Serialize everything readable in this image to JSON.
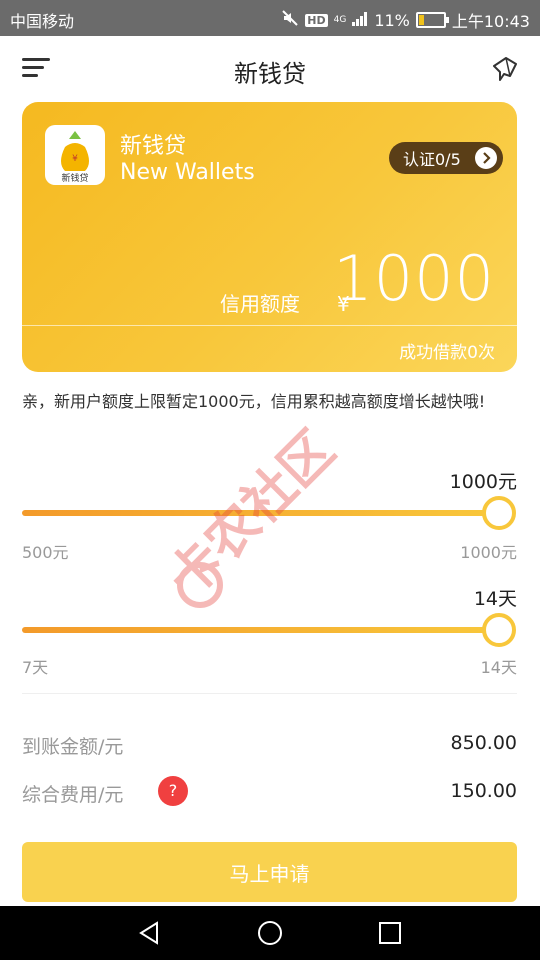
{
  "status_bar": {
    "carrier": "中国移动",
    "battery": "11%",
    "time": "上午10:43",
    "hd_label": "HD",
    "network_label": "4G"
  },
  "header": {
    "title": "新钱贷"
  },
  "card": {
    "app_name": "新钱贷",
    "app_name_en": "New Wallets",
    "logo_text": "新钱贷",
    "verify_label": "认证0/5",
    "credit_label": "信用额度",
    "currency_symbol": "¥",
    "credit_amount": "1000",
    "success_label": "成功借款0次"
  },
  "notice": "亲，新用户额度上限暂定1000元，信用累积越高额度增长越快哦!",
  "amount_slider": {
    "current": "1000元",
    "min": "500元",
    "max": "1000元",
    "fraction": 1.0
  },
  "term_slider": {
    "current": "14天",
    "min": "7天",
    "max": "14天",
    "fraction": 1.0
  },
  "summary": {
    "received_label": "到账金额/元",
    "received_value": "850.00",
    "fee_label": "综合费用/元",
    "fee_value": "150.00",
    "help_symbol": "?"
  },
  "apply_button": "马上申请",
  "watermark_text": "卡农社区",
  "colors": {
    "accent": "#f8c73b",
    "verify_bg": "#5a3e17",
    "help_badge": "#f04040",
    "button": "#f9d24f"
  },
  "icons": {
    "menu": "menu-icon",
    "message": "message-icon",
    "back": "back-triangle-icon",
    "home": "home-circle-icon",
    "recents": "recents-square-icon"
  }
}
